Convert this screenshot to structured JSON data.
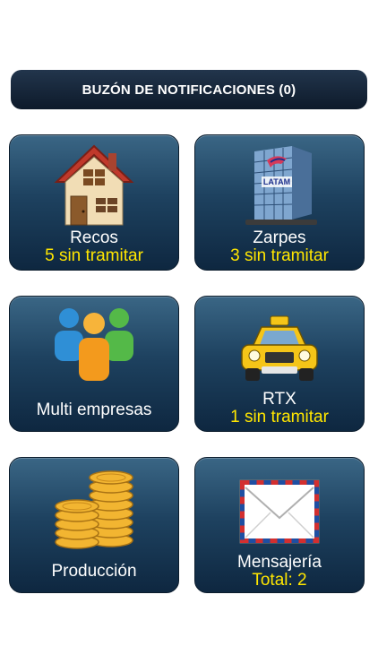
{
  "notification_bar": {
    "label": "BUZÓN DE NOTIFICACIONES (0)"
  },
  "tiles": {
    "recos": {
      "label": "Recos",
      "status": "5 sin tramitar",
      "icon": "house-icon"
    },
    "zarpes": {
      "label": "Zarpes",
      "status": "3 sin tramitar",
      "icon": "latam-building-icon",
      "building_sign": "LATAM"
    },
    "multi": {
      "label": "Multi empresas",
      "icon": "people-group-icon"
    },
    "rtx": {
      "label": "RTX",
      "status": "1 sin tramitar",
      "icon": "taxi-icon"
    },
    "produccion": {
      "label": "Producción",
      "icon": "coins-icon"
    },
    "mensajeria": {
      "label": "Mensajería",
      "status": "Total: 2",
      "icon": "envelope-icon"
    }
  },
  "colors": {
    "tile_top": "#3a6685",
    "tile_bottom": "#0e2740",
    "status_yellow": "#ffe600",
    "bar_bg": "#14243a"
  }
}
